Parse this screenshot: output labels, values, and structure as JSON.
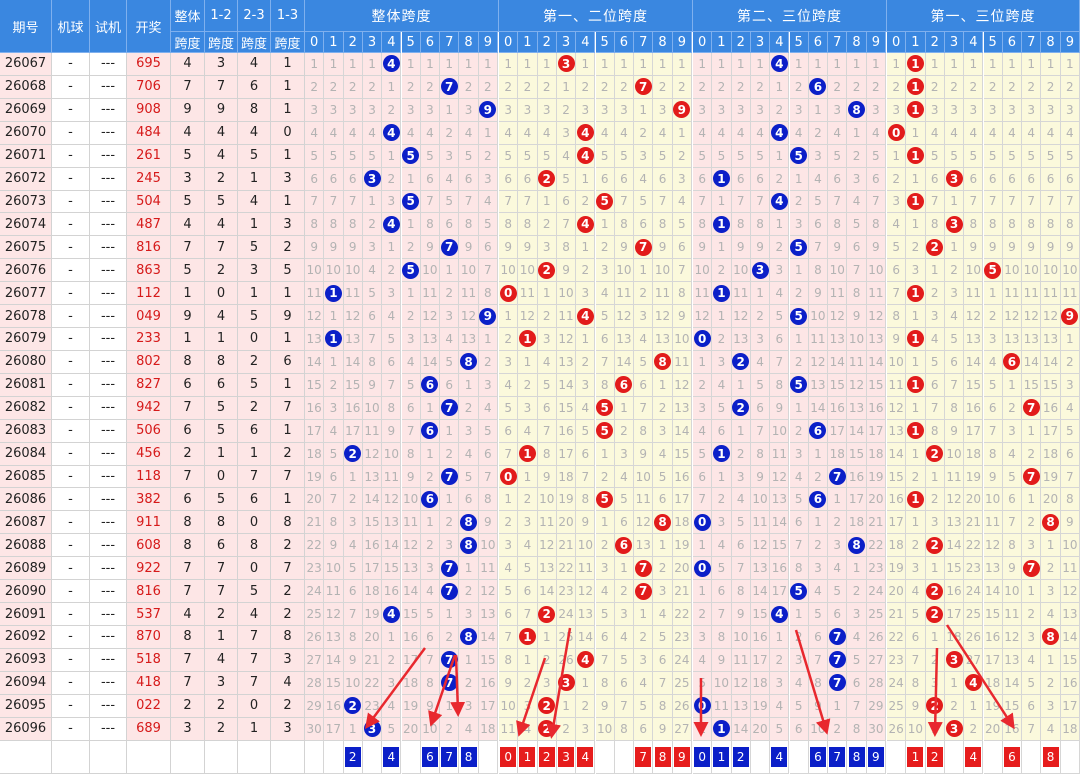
{
  "headers": {
    "period": "期号",
    "machine": "机球",
    "trial": "试机",
    "draw": "开奖",
    "overall_a": "整体",
    "overall_b": "跨度",
    "s12_a": "1-2",
    "s12_b": "跨度",
    "s23_a": "2-3",
    "s23_b": "跨度",
    "s13_a": "1-3",
    "s13_b": "跨度",
    "groups": [
      "整体跨度",
      "第一、二位跨度",
      "第二、三位跨度",
      "第一、三位跨度"
    ],
    "digits": [
      "0",
      "1",
      "2",
      "3",
      "4",
      "5",
      "6",
      "7",
      "8",
      "9"
    ]
  },
  "rows": [
    {
      "period": "26067",
      "machine": "-",
      "trial": "---",
      "draw": "695",
      "span": "4",
      "s12": "3",
      "s23": "4",
      "s13": "1"
    },
    {
      "period": "26068",
      "machine": "-",
      "trial": "---",
      "draw": "706",
      "span": "7",
      "s12": "7",
      "s23": "6",
      "s13": "1"
    },
    {
      "period": "26069",
      "machine": "-",
      "trial": "---",
      "draw": "908",
      "span": "9",
      "s12": "9",
      "s23": "8",
      "s13": "1"
    },
    {
      "period": "26070",
      "machine": "-",
      "trial": "---",
      "draw": "484",
      "span": "4",
      "s12": "4",
      "s23": "4",
      "s13": "0"
    },
    {
      "period": "26071",
      "machine": "-",
      "trial": "---",
      "draw": "261",
      "span": "5",
      "s12": "4",
      "s23": "5",
      "s13": "1"
    },
    {
      "period": "26072",
      "machine": "-",
      "trial": "---",
      "draw": "245",
      "span": "3",
      "s12": "2",
      "s23": "1",
      "s13": "3"
    },
    {
      "period": "26073",
      "machine": "-",
      "trial": "---",
      "draw": "504",
      "span": "5",
      "s12": "5",
      "s23": "4",
      "s13": "1"
    },
    {
      "period": "26074",
      "machine": "-",
      "trial": "---",
      "draw": "487",
      "span": "4",
      "s12": "4",
      "s23": "1",
      "s13": "3"
    },
    {
      "period": "26075",
      "machine": "-",
      "trial": "---",
      "draw": "816",
      "span": "7",
      "s12": "7",
      "s23": "5",
      "s13": "2"
    },
    {
      "period": "26076",
      "machine": "-",
      "trial": "---",
      "draw": "863",
      "span": "5",
      "s12": "2",
      "s23": "3",
      "s13": "5"
    },
    {
      "period": "26077",
      "machine": "-",
      "trial": "---",
      "draw": "112",
      "span": "1",
      "s12": "0",
      "s23": "1",
      "s13": "1"
    },
    {
      "period": "26078",
      "machine": "-",
      "trial": "---",
      "draw": "049",
      "span": "9",
      "s12": "4",
      "s23": "5",
      "s13": "9"
    },
    {
      "period": "26079",
      "machine": "-",
      "trial": "---",
      "draw": "233",
      "span": "1",
      "s12": "1",
      "s23": "0",
      "s13": "1"
    },
    {
      "period": "26080",
      "machine": "-",
      "trial": "---",
      "draw": "802",
      "span": "8",
      "s12": "8",
      "s23": "2",
      "s13": "6"
    },
    {
      "period": "26081",
      "machine": "-",
      "trial": "---",
      "draw": "827",
      "span": "6",
      "s12": "6",
      "s23": "5",
      "s13": "1"
    },
    {
      "period": "26082",
      "machine": "-",
      "trial": "---",
      "draw": "942",
      "span": "7",
      "s12": "5",
      "s23": "2",
      "s13": "7"
    },
    {
      "period": "26083",
      "machine": "-",
      "trial": "---",
      "draw": "506",
      "span": "6",
      "s12": "5",
      "s23": "6",
      "s13": "1"
    },
    {
      "period": "26084",
      "machine": "-",
      "trial": "---",
      "draw": "456",
      "span": "2",
      "s12": "1",
      "s23": "1",
      "s13": "2"
    },
    {
      "period": "26085",
      "machine": "-",
      "trial": "---",
      "draw": "118",
      "span": "7",
      "s12": "0",
      "s23": "7",
      "s13": "7"
    },
    {
      "period": "26086",
      "machine": "-",
      "trial": "---",
      "draw": "382",
      "span": "6",
      "s12": "5",
      "s23": "6",
      "s13": "1"
    },
    {
      "period": "26087",
      "machine": "-",
      "trial": "---",
      "draw": "911",
      "span": "8",
      "s12": "8",
      "s23": "0",
      "s13": "8"
    },
    {
      "period": "26088",
      "machine": "-",
      "trial": "---",
      "draw": "608",
      "span": "8",
      "s12": "6",
      "s23": "8",
      "s13": "2"
    },
    {
      "period": "26089",
      "machine": "-",
      "trial": "---",
      "draw": "922",
      "span": "7",
      "s12": "7",
      "s23": "0",
      "s13": "7"
    },
    {
      "period": "26090",
      "machine": "-",
      "trial": "---",
      "draw": "816",
      "span": "7",
      "s12": "7",
      "s23": "5",
      "s13": "2"
    },
    {
      "period": "26091",
      "machine": "-",
      "trial": "---",
      "draw": "537",
      "span": "4",
      "s12": "2",
      "s23": "4",
      "s13": "2"
    },
    {
      "period": "26092",
      "machine": "-",
      "trial": "---",
      "draw": "870",
      "span": "8",
      "s12": "1",
      "s23": "7",
      "s13": "8"
    },
    {
      "period": "26093",
      "machine": "-",
      "trial": "---",
      "draw": "518",
      "span": "7",
      "s12": "4",
      "s23": "7",
      "s13": "3"
    },
    {
      "period": "26094",
      "machine": "-",
      "trial": "---",
      "draw": "418",
      "span": "7",
      "s12": "3",
      "s23": "7",
      "s13": "4"
    },
    {
      "period": "26095",
      "machine": "-",
      "trial": "---",
      "draw": "022",
      "span": "2",
      "s12": "2",
      "s23": "0",
      "s13": "2"
    },
    {
      "period": "26096",
      "machine": "-",
      "trial": "---",
      "draw": "689",
      "span": "3",
      "s12": "2",
      "s23": "1",
      "s13": "3"
    }
  ],
  "picks": {
    "overall": [
      "2",
      "4",
      "6",
      "7",
      "8"
    ],
    "s12": [
      "0",
      "1",
      "2",
      "3",
      "4",
      "7",
      "8",
      "9"
    ],
    "s23": [
      "0",
      "1",
      "2",
      "4",
      "6",
      "7",
      "8",
      "9"
    ],
    "s13": [
      "1",
      "2",
      "4",
      "6",
      "8"
    ]
  },
  "colors": {
    "header_blue": "#3a87e0",
    "ball_blue": "#0b1fc8",
    "ball_red": "#e21b1b",
    "omission_pink": "#fde6e6",
    "omission_yellow": "#fbf9dc",
    "arrow_red": "#e8282e",
    "draw_text_red": "#d61a1a"
  }
}
